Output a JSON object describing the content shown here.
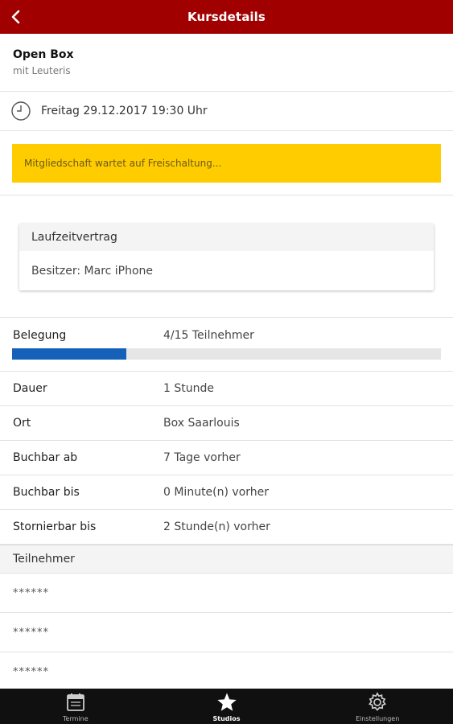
{
  "appbar": {
    "title": "Kursdetails",
    "back_icon": "chevron-left-icon"
  },
  "course": {
    "name": "Open Box",
    "trainer": "mit Leuteris"
  },
  "date": {
    "icon": "clock-icon",
    "text": "Freitag 29.12.2017 19:30 Uhr"
  },
  "notice": {
    "text": "Mitgliedschaft wartet auf Freischaltung...",
    "color": "#ffcc00"
  },
  "contract": {
    "title": "Laufzeitvertrag",
    "owner": "Besitzer: Marc iPhone"
  },
  "belegung": {
    "label": "Belegung",
    "value": "4/15 Teilnehmer",
    "filled": 4,
    "capacity": 15,
    "bar_color": "#1560b9"
  },
  "details": [
    {
      "key": "Dauer",
      "value": "1 Stunde"
    },
    {
      "key": "Ort",
      "value": "Box Saarlouis"
    },
    {
      "key": "Buchbar ab",
      "value": "7 Tage vorher"
    },
    {
      "key": "Buchbar bis",
      "value": "0 Minute(n) vorher"
    },
    {
      "key": "Stornierbar bis",
      "value": "2 Stunde(n) vorher"
    }
  ],
  "participants": {
    "title": "Teilnehmer",
    "items": [
      "******",
      "******",
      "******"
    ]
  },
  "nav": [
    {
      "label": "Termine",
      "icon": "calendar-icon",
      "active": false
    },
    {
      "label": "Studios",
      "icon": "star-icon",
      "active": true
    },
    {
      "label": "Einstellungen",
      "icon": "gear-icon",
      "active": false
    }
  ],
  "colors": {
    "appbar": "#a10000",
    "nav": "#101010"
  }
}
